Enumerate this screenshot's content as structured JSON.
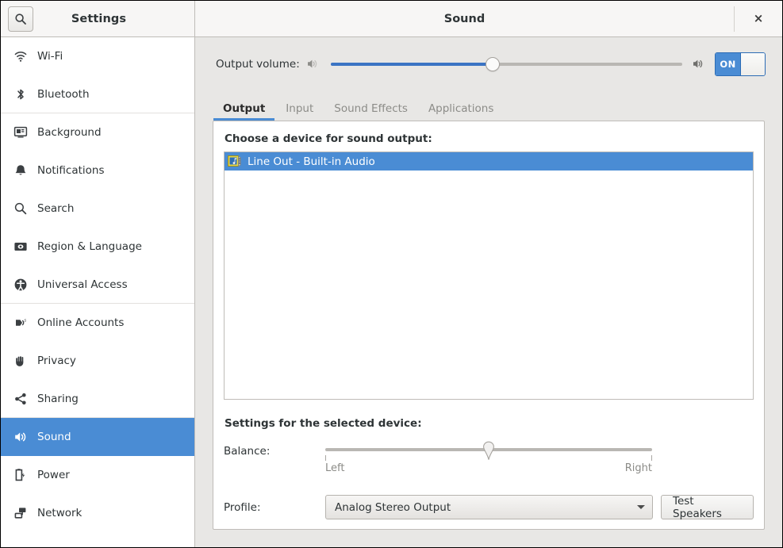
{
  "window": {
    "settings_title": "Settings",
    "panel_title": "Sound",
    "close_label": "×",
    "search_icon": "search-icon"
  },
  "sidebar": {
    "items": [
      {
        "label": "Wi-Fi",
        "icon": "wifi-icon",
        "selected": false
      },
      {
        "label": "Bluetooth",
        "icon": "bluetooth-icon",
        "selected": false
      },
      {
        "label": "Background",
        "icon": "background-icon",
        "selected": false
      },
      {
        "label": "Notifications",
        "icon": "bell-icon",
        "selected": false
      },
      {
        "label": "Search",
        "icon": "search-icon",
        "selected": false
      },
      {
        "label": "Region & Language",
        "icon": "region-language-icon",
        "selected": false
      },
      {
        "label": "Universal Access",
        "icon": "accessibility-icon",
        "selected": false
      },
      {
        "label": "Online Accounts",
        "icon": "online-accounts-icon",
        "selected": false
      },
      {
        "label": "Privacy",
        "icon": "hand-icon",
        "selected": false
      },
      {
        "label": "Sharing",
        "icon": "share-icon",
        "selected": false
      },
      {
        "label": "Sound",
        "icon": "speaker-icon",
        "selected": true
      },
      {
        "label": "Power",
        "icon": "battery-icon",
        "selected": false
      },
      {
        "label": "Network",
        "icon": "network-icon",
        "selected": false
      }
    ]
  },
  "output_volume": {
    "label": "Output volume:",
    "left_icon": "speaker-low-icon",
    "right_icon": "speaker-high-icon",
    "value_percent": 46,
    "toggle_label": "ON",
    "toggle_state": "on"
  },
  "tabs": [
    {
      "label": "Output",
      "active": true
    },
    {
      "label": "Input",
      "active": false
    },
    {
      "label": "Sound Effects",
      "active": false
    },
    {
      "label": "Applications",
      "active": false
    }
  ],
  "device_section": {
    "heading": "Choose a device for sound output:",
    "devices": [
      {
        "label": "Line Out - Built-in Audio",
        "icon": "audio-card-icon",
        "selected": true
      }
    ]
  },
  "device_settings": {
    "heading": "Settings for the selected device:",
    "balance": {
      "label": "Balance:",
      "left_end": "Left",
      "right_end": "Right",
      "value_percent": 50
    },
    "profile": {
      "label": "Profile:",
      "selected": "Analog Stereo Output",
      "arrow_icon": "chevron-down-icon"
    },
    "test_speakers_label": "Test Speakers"
  },
  "colors": {
    "accent_blue": "#4a8cd4",
    "slider_blue": "#3b74c4",
    "panel_bg": "#e8e7e5",
    "text": "#2e3436"
  }
}
